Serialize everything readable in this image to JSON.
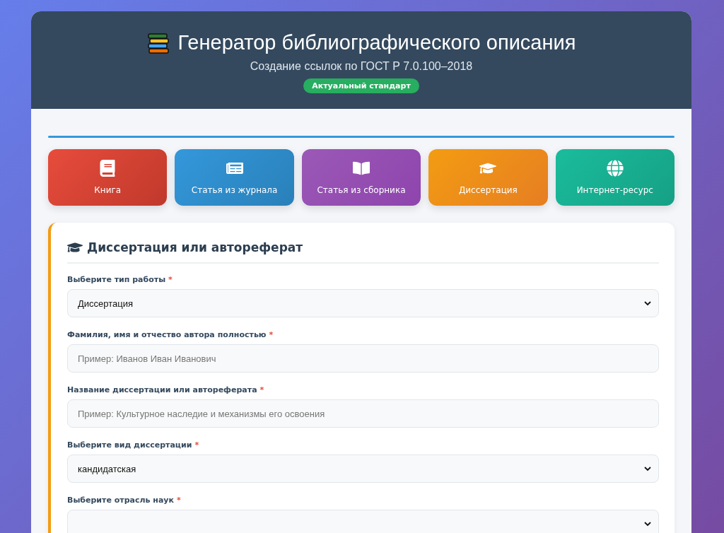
{
  "header": {
    "title": "Генератор библиографического описания",
    "subtitle": "Создание ссылок по ГОСТ Р 7.0.100–2018",
    "badge": "Актуальный стандарт"
  },
  "source_types": [
    {
      "kind": "book",
      "label": "Книга"
    },
    {
      "kind": "journal",
      "label": "Статья из журнала"
    },
    {
      "kind": "collection",
      "label": "Статья из сборника"
    },
    {
      "kind": "dissertation",
      "label": "Диссертация"
    },
    {
      "kind": "web",
      "label": "Интернет-ресурс"
    }
  ],
  "form": {
    "title": "Диссертация или автореферат",
    "fields": [
      {
        "kind": "select",
        "label": "Выберите тип работы",
        "required_mark": "*",
        "value": "Диссертация"
      },
      {
        "kind": "text",
        "label": "Фамилия, имя и отчество автора полностью",
        "required_mark": "*",
        "placeholder": "Пример: Иванов Иван Иванович"
      },
      {
        "kind": "text",
        "label": "Название диссертации или автореферата",
        "required_mark": "*",
        "placeholder": "Пример: Культурное наследие и механизмы его освоения"
      },
      {
        "kind": "select",
        "label": "Выберите вид диссертации",
        "required_mark": "*",
        "value": "кандидатская"
      },
      {
        "kind": "select",
        "label": "Выберите отрасль наук",
        "required_mark": "*"
      }
    ]
  }
}
